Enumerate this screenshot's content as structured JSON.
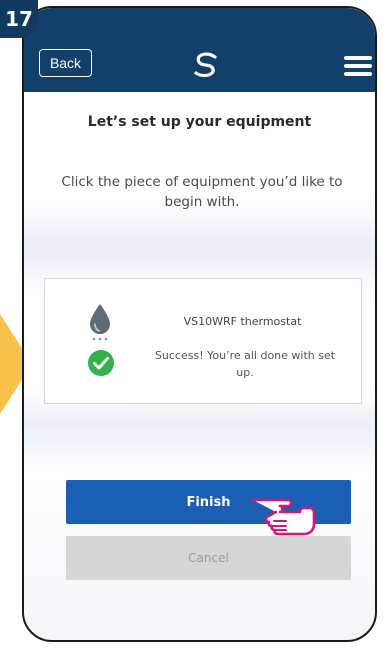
{
  "step": {
    "number": "17"
  },
  "header": {
    "back_label": "Back",
    "logo_icon": "swirl-logo-icon",
    "menu_icon": "hamburger-menu-icon"
  },
  "main": {
    "title": "Let’s set up your equipment",
    "subtitle": "Click the piece of equipment you’d like to begin with.",
    "device": {
      "icon": "water-drop-icon",
      "name": "VS10WRF thermostat",
      "status_icon": "checkmark-circle-icon",
      "status": "Success! You’re all done with set up."
    }
  },
  "actions": {
    "finish_label": "Finish",
    "cancel_label": "Cancel"
  },
  "colors": {
    "header": "#133f6b",
    "step_badge": "#12395f",
    "finish_button": "#1a5fb4",
    "cancel_button": "#d6d6d6",
    "success": "#2fb34a",
    "pointer_accent": "#d6157a",
    "side_arrow": "#f7c14a"
  }
}
